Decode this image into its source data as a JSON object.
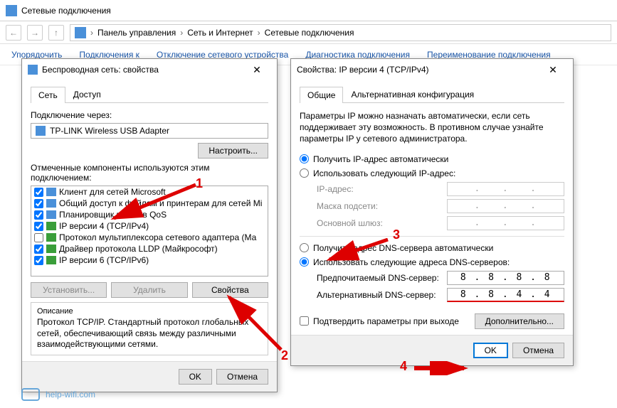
{
  "explorer": {
    "title": "Сетевые подключения",
    "breadcrumb": [
      "Панель управления",
      "Сеть и Интернет",
      "Сетевые подключения"
    ],
    "toolbar": [
      "Упорядочить",
      "Подключения к",
      "Отключение сетевого устройства",
      "Диагностика подключения",
      "Переименование подключения"
    ]
  },
  "dlg1": {
    "title": "Беспроводная сеть: свойства",
    "tabs": [
      "Сеть",
      "Доступ"
    ],
    "connect_via_label": "Подключение через:",
    "adapter": "TP-LINK Wireless USB Adapter",
    "configure_btn": "Настроить...",
    "components_label": "Отмеченные компоненты используются этим подключением:",
    "components": [
      {
        "checked": true,
        "label": "Клиент для сетей Microsoft"
      },
      {
        "checked": true,
        "label": "Общий доступ к файлам и принтерам для сетей Mi"
      },
      {
        "checked": true,
        "label": "Планировщик пакетов QoS"
      },
      {
        "checked": true,
        "label": "IP версии 4 (TCP/IPv4)"
      },
      {
        "checked": false,
        "label": "Протокол мультиплексора сетевого адаптера (Ма"
      },
      {
        "checked": true,
        "label": "Драйвер протокола LLDP (Майкрософт)"
      },
      {
        "checked": true,
        "label": "IP версии 6 (TCP/IPv6)"
      }
    ],
    "install_btn": "Установить...",
    "remove_btn": "Удалить",
    "props_btn": "Свойства",
    "desc_title": "Описание",
    "desc_text": "Протокол TCP/IP. Стандартный протокол глобальных сетей, обеспечивающий связь между различными взаимодействующими сетями.",
    "ok": "OK",
    "cancel": "Отмена"
  },
  "dlg2": {
    "title": "Свойства: IP версии 4 (TCP/IPv4)",
    "tabs": [
      "Общие",
      "Альтернативная конфигурация"
    ],
    "intro": "Параметры IP можно назначать автоматически, если сеть поддерживает эту возможность. В противном случае узнайте параметры IP у сетевого администратора.",
    "ip_auto": "Получить IP-адрес автоматически",
    "ip_manual": "Использовать следующий IP-адрес:",
    "ip_addr": "IP-адрес:",
    "mask": "Маска подсети:",
    "gateway": "Основной шлюз:",
    "dns_auto": "Получить адрес DNS-сервера автоматически",
    "dns_manual": "Использовать следующие адреса DNS-серверов:",
    "dns_pref": "Предпочитаемый DNS-сервер:",
    "dns_alt": "Альтернативный DNS-сервер:",
    "dns_pref_val": "8 . 8 . 8 . 8",
    "dns_alt_val": "8 . 8 . 4 . 4",
    "confirm_exit": "Подтвердить параметры при выходе",
    "advanced": "Дополнительно...",
    "ok": "OK",
    "cancel": "Отмена"
  },
  "anno": {
    "n1": "1",
    "n2": "2",
    "n3": "3",
    "n4": "4"
  },
  "watermark": "help-wifi.com"
}
